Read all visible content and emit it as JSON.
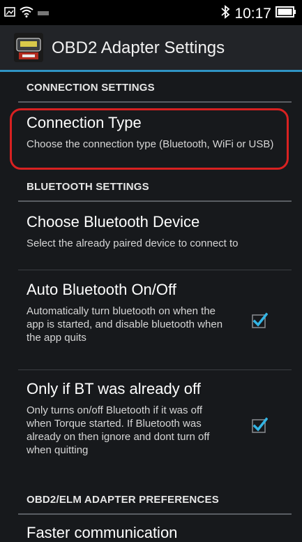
{
  "status_bar": {
    "time": "10:17",
    "bluetooth_icon": "bluetooth-icon",
    "battery_icon": "battery-icon",
    "wifi_icon": "wifi-icon",
    "notification_icon": "image-notification-icon"
  },
  "action_bar": {
    "title": "OBD2 Adapter Settings",
    "app_icon": "torque-app-icon"
  },
  "sections": {
    "connection": {
      "header": "CONNECTION SETTINGS"
    },
    "bluetooth": {
      "header": "BLUETOOTH SETTINGS"
    },
    "adapter": {
      "header": "OBD2/ELM ADAPTER PREFERENCES"
    }
  },
  "prefs": {
    "connection_type": {
      "title": "Connection Type",
      "summary": "Choose the connection type (Bluetooth, WiFi or USB)"
    },
    "choose_bt_device": {
      "title": "Choose Bluetooth Device",
      "summary": "Select the already paired device to connect to"
    },
    "auto_bt": {
      "title": "Auto Bluetooth On/Off",
      "summary": "Automatically turn bluetooth on when the app is started, and disable bluetooth when the app quits",
      "checked": true
    },
    "only_if_bt_off": {
      "title": "Only if BT was already off",
      "summary": "Only turns on/off Bluetooth if it was off when Torque started. If Bluetooth was already on then ignore and dont turn off when quitting",
      "checked": true
    },
    "faster_comm": {
      "title": "Faster communication"
    }
  },
  "colors": {
    "accent": "#2f94c4",
    "highlight": "#d82121",
    "checkbox": "#33b5e5",
    "background": "#17191c"
  }
}
